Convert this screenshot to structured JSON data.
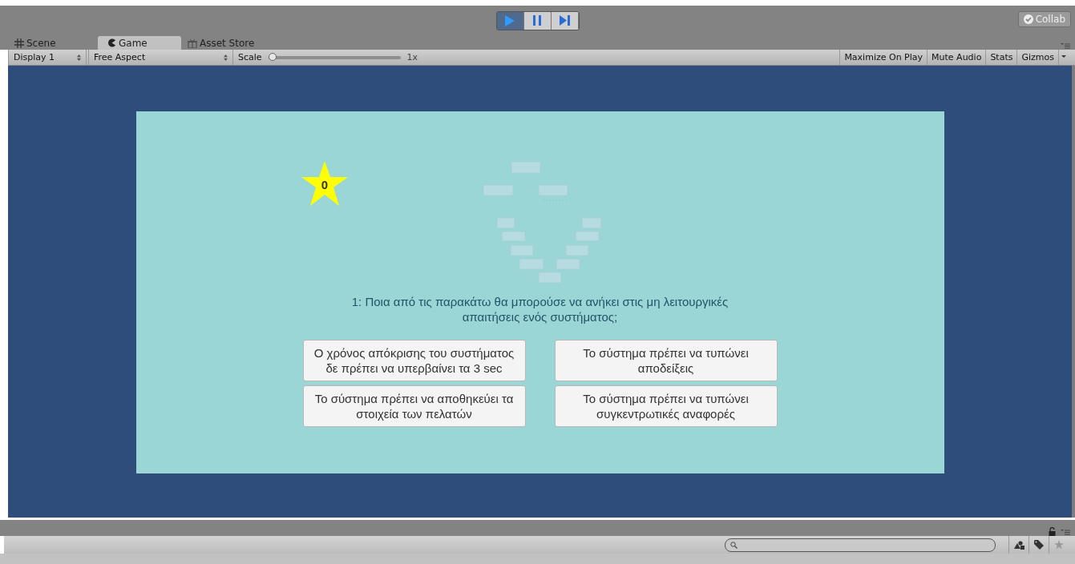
{
  "toolbar": {
    "playback_buttons": [
      {
        "kind": "play",
        "selected": true
      },
      {
        "kind": "pause",
        "selected": false
      },
      {
        "kind": "step",
        "selected": false
      }
    ],
    "collab_button": "Collab"
  },
  "tabs": [
    {
      "label": "Scene",
      "kind": "scene",
      "selected": false
    },
    {
      "label": "Game",
      "kind": "game",
      "selected": true
    },
    {
      "label": "Asset Store",
      "kind": "store",
      "selected": false
    }
  ],
  "game_toolbar": {
    "display": "Display 1",
    "aspect": "Free Aspect",
    "scale_label": "Scale",
    "scale": {
      "level": 0
    },
    "scale_reading": "1x",
    "toggles": [
      {
        "label": "Maximize On Play",
        "on": false
      },
      {
        "label": "Mute Audio",
        "on": false
      },
      {
        "label": "Stats",
        "on": false
      },
      {
        "label": "Gizmos",
        "on": false
      }
    ]
  },
  "game": {
    "score": "0",
    "question": "1: Ποια από τις παρακάτω θα μπορούσε να ανήκει στις μη λειτουργικές απαιτήσεις ενός συστήματος;",
    "answers": [
      "Ο χρόνος απόκρισης του συστήματος δε πρέπει να υπερβαίνει τα 3 sec",
      "Το σύστημα πρέπει να τυπώνει αποδείξεις",
      "Το σύστημα πρέπει να αποθηκεύει τα στοιχεία των πελατών",
      "Το σύστημα πρέπει να τυπώνει συγκεντρωτικές αναφορές"
    ]
  }
}
